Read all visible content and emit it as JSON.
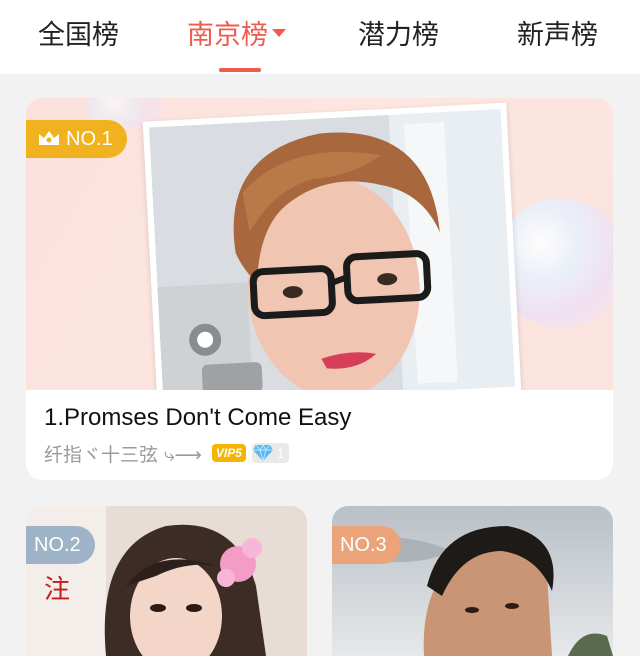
{
  "tabs": [
    {
      "label": "全国榜"
    },
    {
      "label": "南京榜",
      "active": true
    },
    {
      "label": "潜力榜"
    },
    {
      "label": "新声榜"
    }
  ],
  "featured": {
    "rank": "NO.1",
    "title": "1.Promses Don't Come Easy",
    "artist": "纤指ヾ十三弦 ⤷⟶",
    "vip_label": "VIP5",
    "gem_count": "1"
  },
  "cards": [
    {
      "rank": "NO.2"
    },
    {
      "rank": "NO.3"
    }
  ],
  "colors": {
    "accent": "#ef5a4c",
    "badge_gold": "#f0b21e",
    "badge_blue": "#9fb3c8",
    "badge_orange": "#eba37a"
  }
}
